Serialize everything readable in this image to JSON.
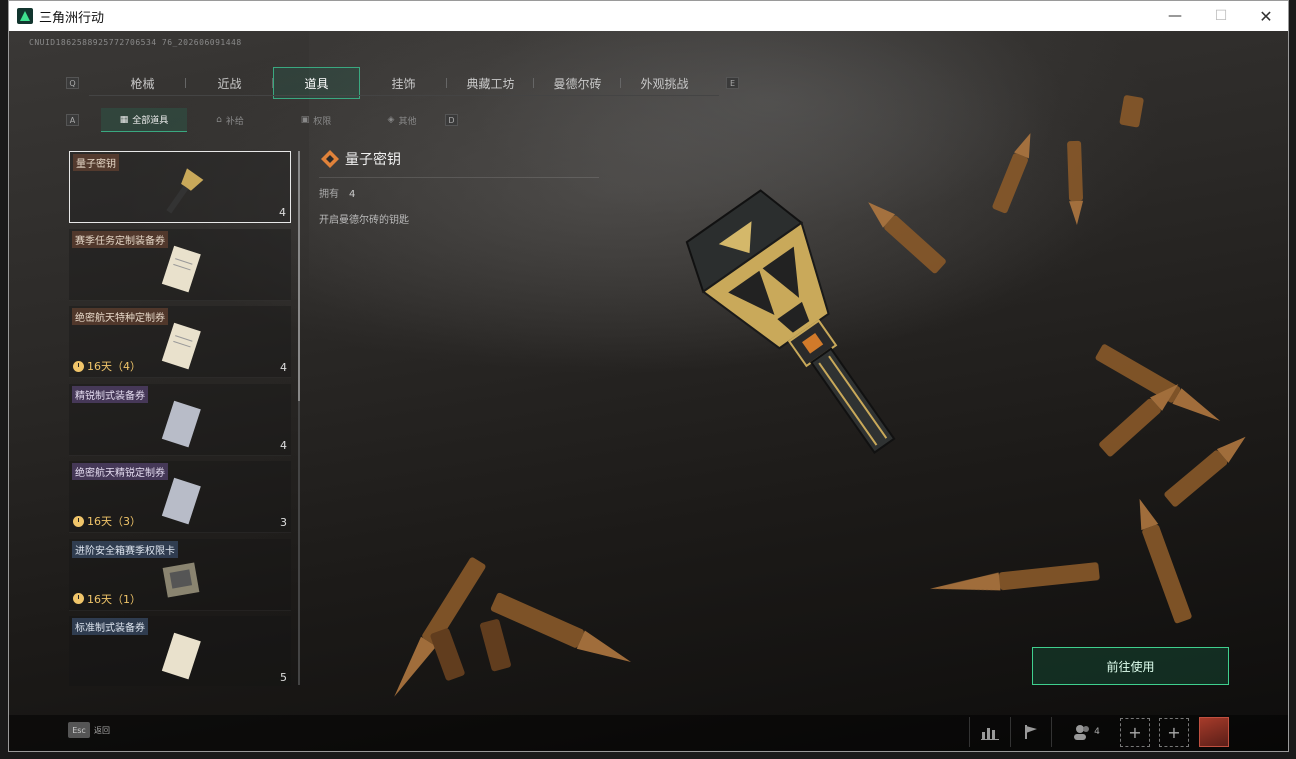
{
  "window": {
    "title": "三角洲行动"
  },
  "header": {
    "cnuid": "CNUID1862588925772706534 76_202606091448"
  },
  "tabs": {
    "left_key": "Q",
    "right_key": "E",
    "items": [
      {
        "label": "枪械"
      },
      {
        "label": "近战"
      },
      {
        "label": "道具"
      },
      {
        "label": "挂饰"
      },
      {
        "label": "典藏工坊"
      },
      {
        "label": "曼德尔砖"
      },
      {
        "label": "外观挑战"
      }
    ],
    "active_index": 2
  },
  "subtabs": {
    "left_key": "A",
    "right_key": "D",
    "items": [
      {
        "label": "全部道具"
      },
      {
        "label": "补给"
      },
      {
        "label": "权限"
      },
      {
        "label": "其他"
      }
    ]
  },
  "items": [
    {
      "name": "量子密钥",
      "count": "4",
      "timer": "",
      "label_style": "brown"
    },
    {
      "name": "赛季任务定制装备券",
      "count": "",
      "timer": "",
      "label_style": "brown"
    },
    {
      "name": "绝密航天特种定制券",
      "count": "4",
      "timer": "16天（4）",
      "label_style": "brown"
    },
    {
      "name": "精锐制式装备券",
      "count": "4",
      "timer": "",
      "label_style": "purple"
    },
    {
      "name": "绝密航天精锐定制券",
      "count": "3",
      "timer": "16天（3）",
      "label_style": "purple"
    },
    {
      "name": "进阶安全箱赛季权限卡",
      "count": "",
      "timer": "16天（1）",
      "label_style": "blue"
    },
    {
      "name": "标准制式装备券",
      "count": "5",
      "timer": "",
      "label_style": "blue"
    }
  ],
  "detail": {
    "title": "量子密钥",
    "own_label": "拥有",
    "own_value": "4",
    "description": "开启曼德尔砖的钥匙"
  },
  "action": {
    "goto_label": "前往使用"
  },
  "bottom": {
    "esc_key": "Esc",
    "esc_label": "返回",
    "friends_count": "4"
  },
  "colors": {
    "accent": "#3fcf8e",
    "timer": "#f0c56a"
  }
}
